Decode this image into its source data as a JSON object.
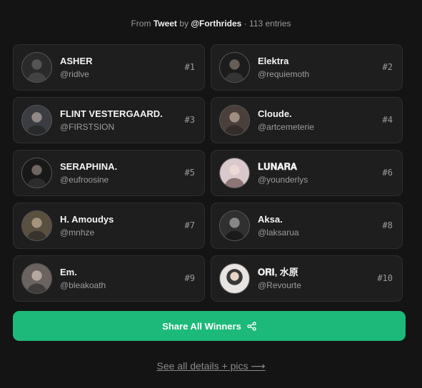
{
  "header": {
    "from_label": "From",
    "source_type": "Tweet",
    "by_label": "by",
    "author": "@Forthrides",
    "entries": "· 113 entries"
  },
  "winners": [
    {
      "name": "ASHER",
      "handle": "@ridlve",
      "rank": "#1",
      "avatar_color": "#2a2a2a"
    },
    {
      "name": "Elektra",
      "handle": "@requiemoth",
      "rank": "#2",
      "avatar_color": "#1c1c1c"
    },
    {
      "name": "FLINT VESTERGAARD.",
      "handle": "@FIRSTSION",
      "rank": "#3",
      "avatar_color": "#3b3d42"
    },
    {
      "name": "Cloude.",
      "handle": "@artcemeterie",
      "rank": "#4",
      "avatar_color": "#4a3f3a"
    },
    {
      "name": "SERAPHINA.",
      "handle": "@eufroosine",
      "rank": "#5",
      "avatar_color": "#181818"
    },
    {
      "name": "𝐋𝐔𝐍𝐀𝐑𝐀",
      "handle": "@younderlys",
      "rank": "#6",
      "avatar_color": "#d9c8cc"
    },
    {
      "name": "H. Amoudys",
      "handle": "@mnhze",
      "rank": "#7",
      "avatar_color": "#5a5040"
    },
    {
      "name": "Aksa.",
      "handle": "@laksarua",
      "rank": "#8",
      "avatar_color": "#303030"
    },
    {
      "name": "Em.",
      "handle": "@bleakoath",
      "rank": "#9",
      "avatar_color": "#6b6360"
    },
    {
      "name": "𝐎𝐑𝐈, 水原",
      "handle": "@Revourte",
      "rank": "#10",
      "avatar_color": "#e8e4e2"
    }
  ],
  "share_button": {
    "label": "Share All Winners",
    "icon": "share-icon"
  },
  "details_link": {
    "label": "See all details + pics ⟶"
  },
  "colors": {
    "accent": "#1db97a",
    "background": "#141414",
    "card": "#1e1e1e"
  }
}
